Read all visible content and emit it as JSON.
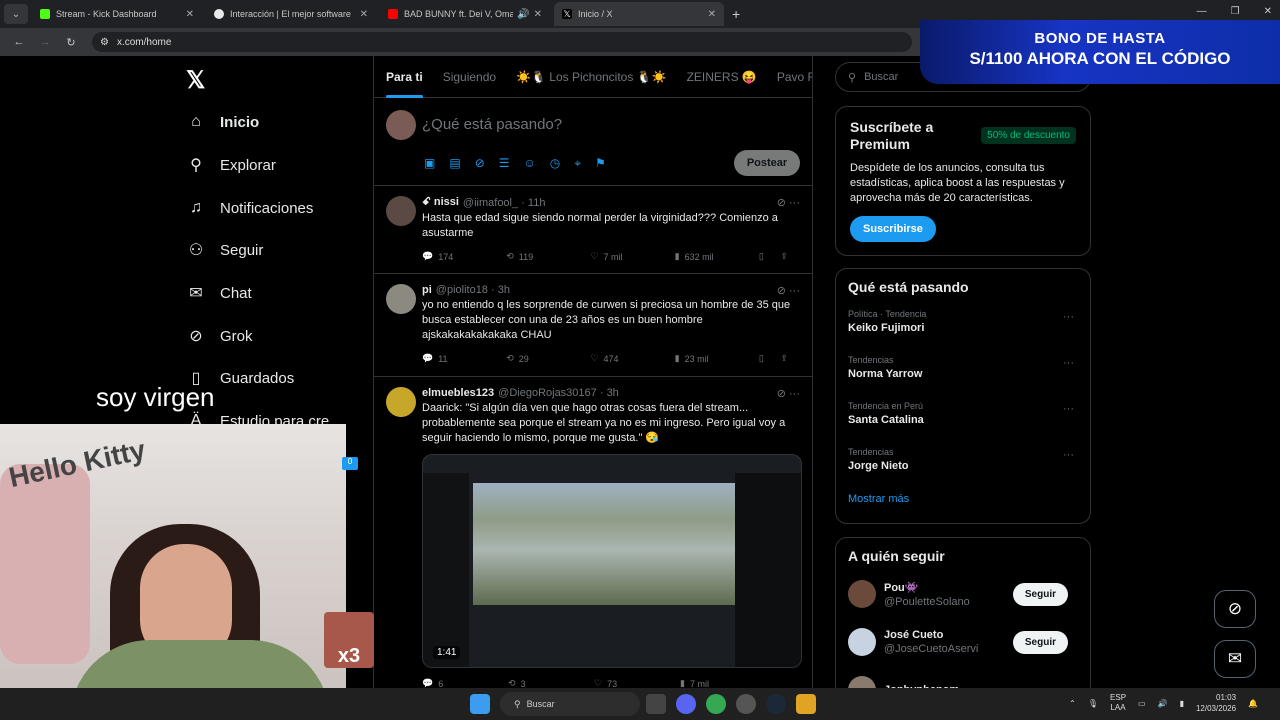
{
  "browser": {
    "tabs": [
      {
        "title": "Stream - Kick Dashboard",
        "color": "#53fc18"
      },
      {
        "title": "Interacción | El mejor software",
        "color": "#e7e9ea"
      },
      {
        "title": "BAD BUNNY ft. Dei V, Oma",
        "color": "#ff0000"
      },
      {
        "title": "Inicio / X",
        "color": "#e7e9ea"
      }
    ],
    "url": "x.com/home"
  },
  "ad": {
    "line1": "BONO DE HASTA",
    "line2": "S/1100 AHORA CON EL CÓDIGO"
  },
  "nav": {
    "logo": "𝕏",
    "items": [
      {
        "label": "Inicio",
        "icon": "home-icon",
        "glyph": "⌂"
      },
      {
        "label": "Explorar",
        "icon": "search-icon",
        "glyph": "⚲"
      },
      {
        "label": "Notificaciones",
        "icon": "bell-icon",
        "glyph": "🔔"
      },
      {
        "label": "Seguir",
        "icon": "add-user-icon",
        "glyph": "👤"
      },
      {
        "label": "Chat",
        "icon": "mail-icon",
        "glyph": "✉"
      },
      {
        "label": "Grok",
        "icon": "grok-icon",
        "glyph": "⊘"
      },
      {
        "label": "Guardados",
        "icon": "bookmark-icon",
        "glyph": "🔖"
      },
      {
        "label": "Estudio para cre...",
        "icon": "studio-icon",
        "glyph": "Ä"
      }
    ]
  },
  "feed": {
    "tabs": [
      "Para ti",
      "Siguiendo",
      "☀️🐧 Los Pichoncitos 🐧☀️",
      "ZEINERS 😝",
      "Pavo Rar"
    ],
    "compose": {
      "placeholder": "¿Qué está pasando?",
      "post_label": "Postear"
    },
    "tweets": [
      {
        "name": "ꗃ nissi",
        "handle": "@iimafool_",
        "time": "11h",
        "text": "Hasta que edad sigue siendo normal perder la virginidad??? Comienzo a asustarme",
        "replies": "174",
        "reposts": "119",
        "likes": "7 mil",
        "views": "632 mil",
        "avatar_color": "#5b4a44"
      },
      {
        "name": "pi",
        "handle": "@piolito18",
        "time": "3h",
        "text": "yo no entiendo q les sorprende de curwen si preciosa un hombre de 35 que busca establecer con una de 23 años es un buen hombre ajskakakakakakaka CHAU",
        "replies": "11",
        "reposts": "29",
        "likes": "474",
        "views": "23 mil",
        "avatar_color": "#8c8a80"
      },
      {
        "name": "elmuebles123",
        "handle": "@DiegoRojas30167",
        "time": "3h",
        "text": "Daarick: \"Si algún día ven que hago otras cosas fuera del stream... probablemente sea porque el stream ya no es mi ingreso. Pero igual voy a seguir haciendo lo mismo, porque me gusta.\" 😪",
        "media_duration": "1:41",
        "replies": "6",
        "reposts": "3",
        "likes": "73",
        "views": "7 mil",
        "avatar_color": "#c7a72a"
      }
    ]
  },
  "sidebar": {
    "search_placeholder": "Buscar",
    "premium": {
      "title": "Suscríbete a Premium",
      "badge": "50% de descuento",
      "desc": "Despídete de los anuncios, consulta tus estadísticas, aplica boost a las respuestas y aprovecha más de 20 características.",
      "button": "Suscribirse"
    },
    "trends_title": "Qué está pasando",
    "trends": [
      {
        "context": "Política · Tendencia",
        "name": "Keiko Fujimori"
      },
      {
        "context": "Tendencias",
        "name": "Norma Yarrow"
      },
      {
        "context": "Tendencia en Perú",
        "name": "Santa Catalina"
      },
      {
        "context": "Tendencias",
        "name": "Jorge Nieto"
      }
    ],
    "show_more": "Mostrar más",
    "follow_title": "A quién seguir",
    "follow": [
      {
        "name": "Pou👾",
        "handle": "@PouletteSolano",
        "button": "Seguir",
        "color": "#6b4a3c"
      },
      {
        "name": "José Cueto",
        "handle": "@JoseCuetoAservi",
        "button": "Seguir",
        "color": "#c7d3e0"
      },
      {
        "name": "Jonhyphenom",
        "handle": "",
        "button": "",
        "color": "#8a7a6e"
      }
    ]
  },
  "overlay": {
    "caption": "soy virgen",
    "cam_text": "Hello Kitty",
    "sticker": "x3",
    "side_badge": "0"
  },
  "taskbar": {
    "search": "Buscar",
    "lang_top": "ESP",
    "lang_bottom": "LAA",
    "time": "01:03",
    "date": "12/03/2026"
  }
}
